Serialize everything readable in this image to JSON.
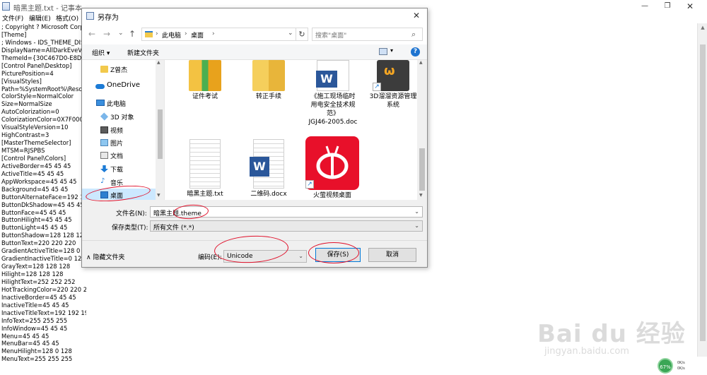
{
  "notepad": {
    "title": "暗黑主题.txt - 记事本",
    "menu": [
      "文件(F)",
      "编辑(E)",
      "格式(O)"
    ],
    "text_lines": [
      "; Copyright ? Microsoft Corp",
      "[Theme]",
      "; Windows - IDS_THEME_DIS",
      "DisplayName=AllDarkEveV2",
      "ThemeId={30C467D0-E8DB-",
      "[Control Panel\\Desktop]",
      "PicturePosition=4",
      "[VisualStyles]",
      "Path=%SystemRoot%\\Resou",
      "ColorStyle=NormalColor",
      "Size=NormalSize",
      "AutoColorization=0",
      "ColorizationColor=0X7F0000",
      "VisualStyleVersion=10",
      "HighContrast=3",
      "[MasterThemeSelector]",
      "MTSM=RJSPBS",
      "[Control Panel\\Colors]",
      "ActiveBorder=45 45 45",
      "ActiveTitle=45 45 45",
      "AppWorkspace=45 45 45",
      "Background=45 45 45",
      "ButtonAlternateFace=192 19",
      "ButtonDkShadow=45 45 45",
      "ButtonFace=45 45 45",
      "ButtonHilight=45 45 45",
      "ButtonLight=45 45 45",
      "ButtonShadow=128 128 128",
      "ButtonText=220 220 220",
      "GradientActiveTitle=128 0 12",
      "GradientInactiveTitle=0 128 0",
      "GrayText=128 128 128",
      "Hilight=128 128 128",
      "HilightText=252 252 252",
      "HotTrackingColor=220 220 220",
      "InactiveBorder=45 45 45",
      "InactiveTitle=45 45 45",
      "InactiveTitleText=192 192 192",
      "InfoText=255 255 255",
      "InfoWindow=45 45 45",
      "Menu=45 45 45",
      "MenuBar=45 45 45",
      "MenuHilight=128 0 128",
      "MenuText=255 255 255"
    ]
  },
  "dialog": {
    "title": "另存为",
    "close": "✕",
    "address": {
      "crumbs": [
        "此电脑",
        "桌面"
      ],
      "sep": "›",
      "dropdown": "⌄",
      "refresh": "↻"
    },
    "search": {
      "placeholder": "搜索\"桌面\"",
      "icon": "⌕"
    },
    "nav_buttons": {
      "back": "←",
      "forward": "→",
      "dropdown": "⌄",
      "up": "↑"
    },
    "toolbar": {
      "organize": "组织 ▾",
      "new_folder": "新建文件夹",
      "view_dd": "▾",
      "help": "?"
    },
    "nav_items": [
      {
        "label": "Z曾杰",
        "icon": "user-folder-icon"
      },
      {
        "label": "OneDrive",
        "icon": "cloud-icon"
      },
      {
        "label": "此电脑",
        "icon": "computer-icon"
      },
      {
        "label": "3D 对象",
        "icon": "3d-objects-icon"
      },
      {
        "label": "视频",
        "icon": "video-icon"
      },
      {
        "label": "图片",
        "icon": "pictures-icon"
      },
      {
        "label": "文档",
        "icon": "documents-icon"
      },
      {
        "label": "下载",
        "icon": "download-icon"
      },
      {
        "label": "音乐",
        "icon": "music-icon"
      },
      {
        "label": "桌面",
        "icon": "desktop-icon"
      }
    ],
    "files": [
      {
        "name": "证件考试",
        "kind": "folder"
      },
      {
        "name": "转正手续",
        "kind": "folder"
      },
      {
        "name": "《施工现场临时用电安全技术规范》JGJ46-2005.doc",
        "kind": "word"
      },
      {
        "name": "3D溜溜资源管理系统",
        "kind": "shortcut-app"
      },
      {
        "name": "暗黑主题.txt",
        "kind": "text"
      },
      {
        "name": "二维码.docx",
        "kind": "word"
      },
      {
        "name": "火萤视频桌面",
        "kind": "shortcut-firefly"
      }
    ],
    "file_lines": {
      "doc_line1": "《施工现场临时",
      "doc_line2": "用电安全技术规",
      "doc_line3": "范》",
      "doc_line4": "JGJ46-2005.doc",
      "app_line1": "3D溜溜资源管理",
      "app_line2": "系统"
    },
    "filename_label": "文件名(N):",
    "filename_value": "暗黑主题.theme",
    "filetype_label": "保存类型(T):",
    "filetype_value": "所有文件 (*.*)",
    "hide_folders": "隐藏文件夹",
    "encoding_label": "编码(E):",
    "encoding_value": "Unicode",
    "save": "保存(S)",
    "cancel": "取消"
  },
  "tray": {
    "percent": "67%",
    "up": "0K/s",
    "down": "0K/s"
  },
  "watermark": {
    "big": "Bai du 经验",
    "small": "jingyan.baidu.com"
  },
  "colors": {
    "accent": "#0078d7",
    "annotation": "#e0102a",
    "selection": "#cce8ff",
    "firefly": "#e8102a"
  }
}
